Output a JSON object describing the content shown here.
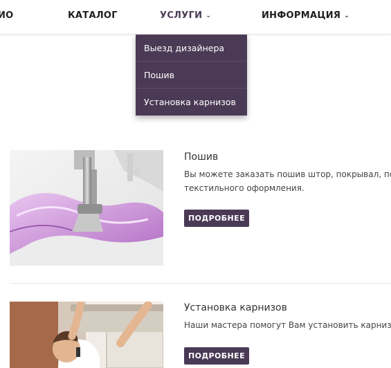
{
  "nav": {
    "partial_label": "ИО",
    "catalog_label": "КАТАЛОГ",
    "services_label": "УСЛУГИ",
    "info_label": "ИНФОРМАЦИЯ",
    "chevron": "⌄"
  },
  "services_menu": {
    "items": [
      {
        "label": "Выезд дизайнера"
      },
      {
        "label": "Пошив"
      },
      {
        "label": "Установка карнизов"
      }
    ]
  },
  "cards": [
    {
      "title": "Пошив",
      "description": "Вы можете заказать пошив штор, покрывал, под текстильного оформления.",
      "button_label": "ПОДРОБНЕЕ",
      "image_icon": "sewing-machine-image"
    },
    {
      "title": "Установка карнизов",
      "description": "Наши мастера помогут Вам установить карнизы",
      "button_label": "ПОДРОБНЕЕ",
      "image_icon": "curtain-installer-image"
    }
  ],
  "colors": {
    "accent": "#4a3a55",
    "divider": "#e8e8e8"
  }
}
